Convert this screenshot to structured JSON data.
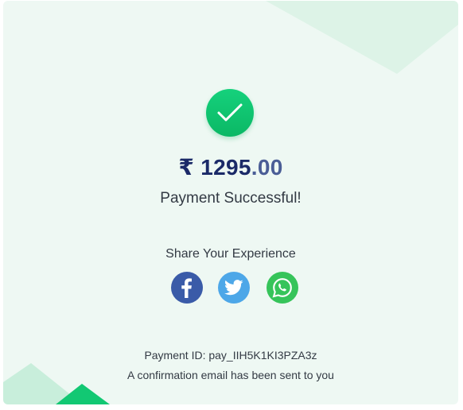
{
  "payment": {
    "currency_symbol": "₹",
    "amount_main": "1295",
    "amount_paise": ".00",
    "status": "Payment Successful!",
    "payment_id_label": "Payment ID:",
    "payment_id": "pay_IIH5K1KI3PZA3z",
    "confirmation": "A confirmation email has been sent to you"
  },
  "share": {
    "title": "Share Your Experience",
    "networks": [
      {
        "name": "Facebook",
        "icon": "facebook-icon",
        "color": "#3a5ba8"
      },
      {
        "name": "Twitter",
        "icon": "twitter-icon",
        "color": "#4da7e8"
      },
      {
        "name": "WhatsApp",
        "icon": "whatsapp-icon",
        "color": "#36c45a"
      }
    ]
  },
  "colors": {
    "background": "#eef8f3",
    "success": "#12c873",
    "amount": "#1b2a68"
  },
  "icons": {
    "success": "checkmark-icon"
  }
}
